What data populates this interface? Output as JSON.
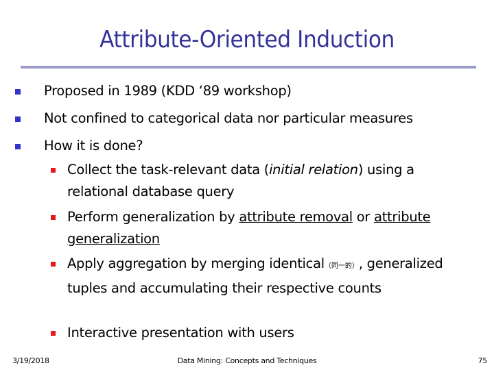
{
  "slide": {
    "title": "Attribute-Oriented Induction",
    "bullets": [
      {
        "text": "Proposed in 1989 (KDD ‘89 workshop)"
      },
      {
        "text": "Not confined to categorical data nor particular measures"
      },
      {
        "text": "How it is done?"
      }
    ],
    "sub_bullets": [
      {
        "pre": "Collect the task-relevant data (",
        "italic": "initial relation",
        "post": ") using a relational database query"
      },
      {
        "pre": "Perform generalization by ",
        "link1": "attribute removal",
        "mid": " or ",
        "link2": "attribute generalization"
      },
      {
        "pre": "Apply aggregation by merging identical",
        "annotation": "（同一的）",
        "post": ", generalized tuples and accumulating their respective counts"
      },
      {
        "text": "Interactive presentation with users"
      }
    ],
    "colors": {
      "title": "#333399",
      "rule": "#9999c8",
      "bullet_level1": "#3333cc",
      "bullet_level2": "#e81818"
    }
  },
  "footer": {
    "date": "3/19/2018",
    "center": "Data Mining: Concepts and Techniques",
    "page": "75"
  }
}
